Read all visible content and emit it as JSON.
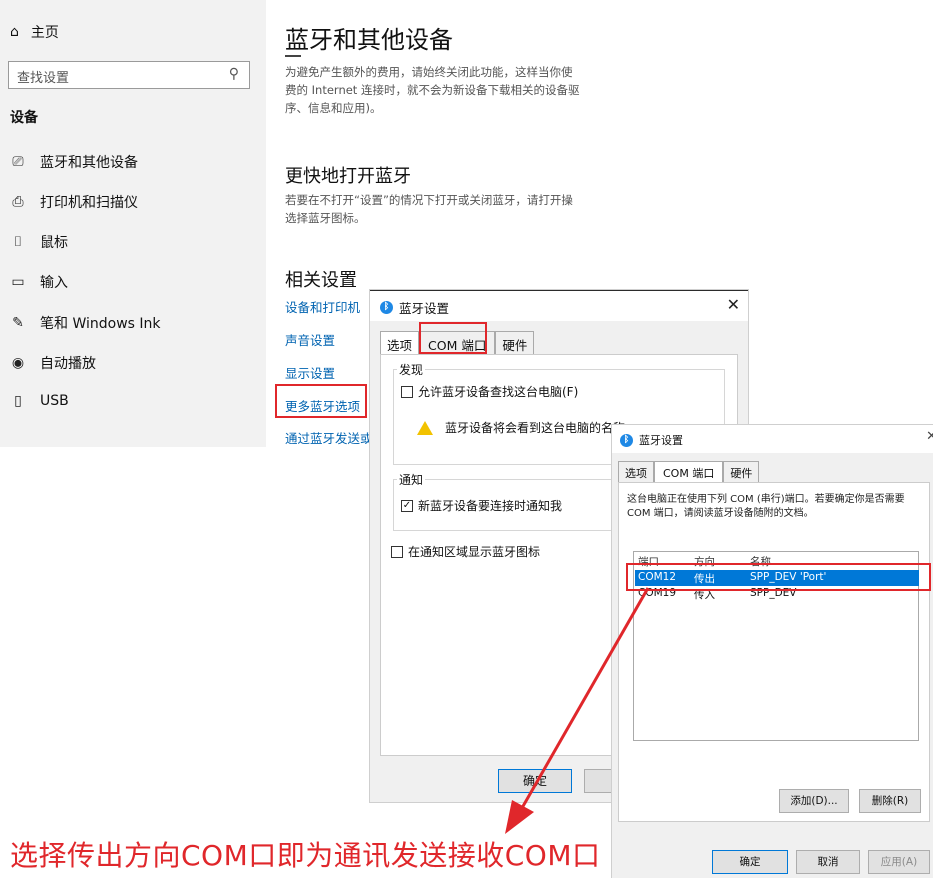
{
  "sidebar": {
    "home_label": "主页",
    "search_placeholder": "查找设置",
    "section_title": "设备",
    "items": [
      {
        "label": "蓝牙和其他设备",
        "icon": "bluetooth-devices-icon"
      },
      {
        "label": "打印机和扫描仪",
        "icon": "printer-icon"
      },
      {
        "label": "鼠标",
        "icon": "mouse-icon"
      },
      {
        "label": "输入",
        "icon": "keyboard-icon"
      },
      {
        "label": "笔和 Windows Ink",
        "icon": "pen-icon"
      },
      {
        "label": "自动播放",
        "icon": "autoplay-icon"
      },
      {
        "label": "USB",
        "icon": "usb-icon"
      }
    ]
  },
  "main": {
    "title": "蓝牙和其他设备",
    "desc_line1": "为避免产生额外的费用，请始终关闭此功能，这样当你使",
    "desc_line2": "费的 Internet 连接时，就不会为新设备下载相关的设备驱",
    "desc_line3": "序、信息和应用)。",
    "quick_title": "更快地打开蓝牙",
    "quick_line1": "若要在不打开“设置”的情况下打开或关闭蓝牙，请打开操",
    "quick_line2": "选择蓝牙图标。",
    "related_title": "相关设置",
    "links": [
      "设备和打印机",
      "声音设置",
      "显示设置",
      "更多蓝牙选项",
      "通过蓝牙发送或接"
    ]
  },
  "dialog1": {
    "title": "蓝牙设置",
    "tabs": [
      "选项",
      "COM 端口",
      "硬件"
    ],
    "discovery_label": "发现",
    "allow_discovery": "允许蓝牙设备查找这台电脑(F)",
    "allow_discovery_checked": false,
    "warning_text": "蓝牙设备将会看到这台电脑的名称。",
    "notify_label": "通知",
    "notify_new": "新蓝牙设备要连接时通知我",
    "notify_new_checked": true,
    "show_tray_icon": "在通知区域显示蓝牙图标",
    "show_tray_icon_checked": false,
    "ok_label": "确定"
  },
  "dialog2": {
    "title": "蓝牙设置",
    "tabs": [
      "选项",
      "COM 端口",
      "硬件"
    ],
    "description": "这台电脑正在使用下列 COM (串行)端口。若要确定你是否需要 COM 端口，请阅读蓝牙设备随附的文档。",
    "columns": [
      "端口",
      "方向",
      "名称"
    ],
    "rows": [
      {
        "port": "COM12",
        "direction": "传出",
        "name": "SPP_DEV 'Port'",
        "selected": true
      },
      {
        "port": "COM19",
        "direction": "传入",
        "name": "SPP_DEV",
        "selected": false
      }
    ],
    "add_label": "添加(D)...",
    "remove_label": "删除(R)",
    "ok_label": "确定",
    "cancel_label": "取消",
    "apply_label": "应用(A)"
  },
  "caption": "选择传出方向COM口即为通讯发送接收COM口",
  "colors": {
    "highlight": "#e0272b",
    "link": "#0063b1",
    "selection": "#0078d7"
  }
}
